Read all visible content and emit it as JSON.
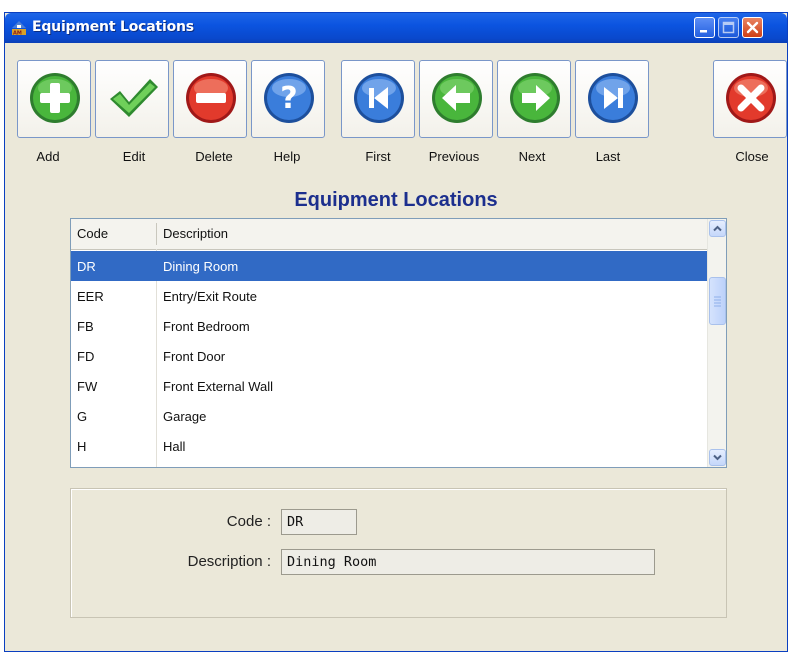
{
  "window": {
    "title": "Equipment Locations"
  },
  "toolbar": {
    "add_label": "Add",
    "edit_label": "Edit",
    "delete_label": "Delete",
    "help_label": "Help",
    "first_label": "First",
    "previous_label": "Previous",
    "next_label": "Next",
    "last_label": "Last",
    "close_label": "Close"
  },
  "heading": "Equipment Locations",
  "grid": {
    "columns": [
      "Code",
      "Description"
    ],
    "rows": [
      {
        "code": "DR",
        "description": "Dining Room",
        "selected": true
      },
      {
        "code": "EER",
        "description": "Entry/Exit Route"
      },
      {
        "code": "FB",
        "description": "Front Bedroom"
      },
      {
        "code": "FD",
        "description": "Front Door"
      },
      {
        "code": "FW",
        "description": "Front External Wall"
      },
      {
        "code": "G",
        "description": "Garage"
      },
      {
        "code": "H",
        "description": "Hall"
      }
    ]
  },
  "detail": {
    "code_label": "Code :",
    "code_value": "DR",
    "description_label": "Description :",
    "description_value": "Dining Room"
  },
  "icons": {
    "add": "plus-icon",
    "edit": "checkmark-icon",
    "delete": "minus-icon",
    "help": "question-icon",
    "first": "first-icon",
    "previous": "arrow-left-icon",
    "next": "arrow-right-icon",
    "last": "last-icon",
    "close": "x-icon"
  },
  "colors": {
    "title_bar": "#0b54e0",
    "selection": "#316ac5",
    "heading_text": "#1c2f8e",
    "window_bg": "#ebe8d9"
  }
}
